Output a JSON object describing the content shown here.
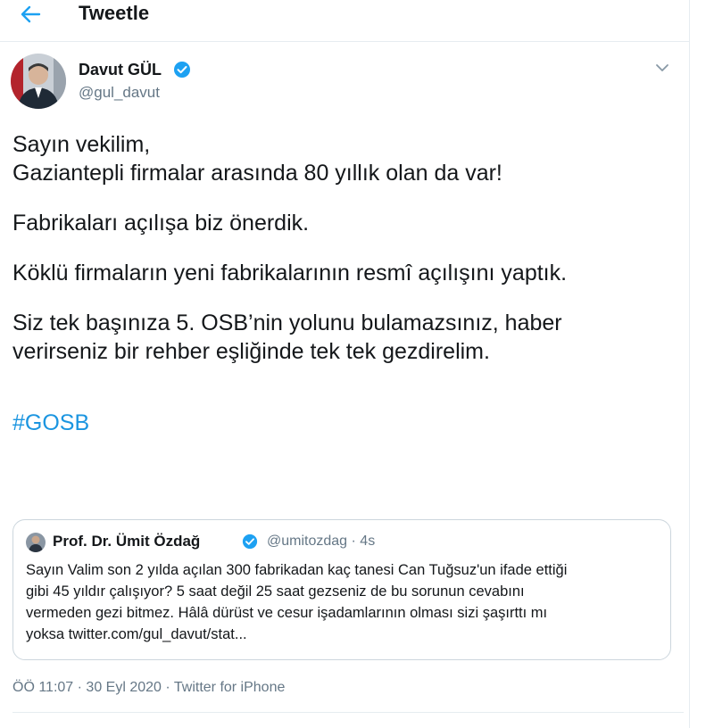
{
  "header": {
    "title": "Tweetle",
    "back_icon": "arrow-left-icon"
  },
  "author": {
    "name": "Davut GÜL",
    "handle": "@gul_davut",
    "verified": true
  },
  "tweet": {
    "lines": [
      "Sayın vekilim,",
      "Gaziantepli firmalar arasında 80 yıllık olan da var!",
      "Fabrikaları açılışa biz önerdik.",
      "Köklü firmaların yeni fabrikalarının resmî açılışını yaptık.",
      "Siz tek başınıza 5. OSB’nin yolunu bulamazsınız, haber",
      "verirseniz bir rehber eşliğinde tek tek gezdirelim."
    ],
    "hashtag": "#GOSB"
  },
  "quoted": {
    "name": "Prof. Dr. Ümit Özdağ",
    "handle": "@umitozdag",
    "separator": "·",
    "time": "4s",
    "lines": [
      "Sayın Valim son 2 yılda açılan 300 fabrikadan kaç tanesi Can Tuğsuz'un ifade ettiği",
      "gibi 45 yıldır çalışıyor? 5 saat değil 25 saat gezseniz de bu sorunun cevabını",
      "vermeden gezi bitmez. Hâlâ dürüst ve cesur işadamlarının olması sizi şaşırttı mı",
      "yoksa twitter.com/gul_davut/stat..."
    ]
  },
  "meta": {
    "time": "ÖÖ 11:07",
    "sep1": "·",
    "date": "30 Eyl 2020",
    "sep2": "·",
    "source": "Twitter for iPhone"
  },
  "colors": {
    "accent": "#1b95e0",
    "verified": "#1da1f2",
    "text": "#14171a",
    "secondary": "#657786",
    "border": "#ccd6dd"
  }
}
